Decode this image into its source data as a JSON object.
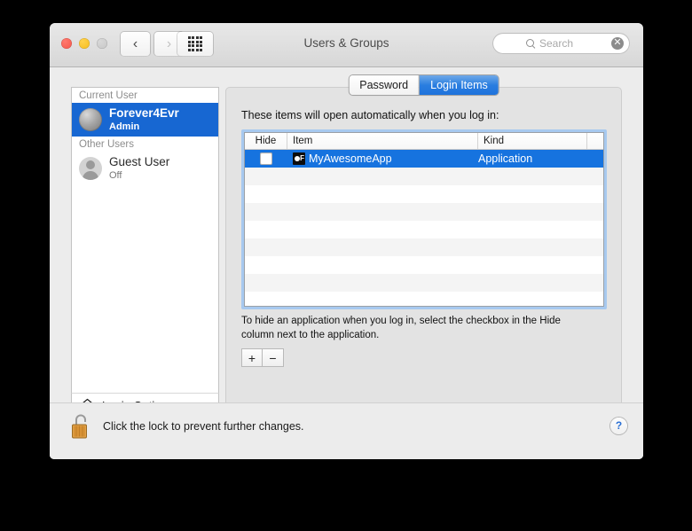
{
  "window": {
    "title": "Users & Groups",
    "traffic_lights": [
      "close",
      "minimize",
      "zoom"
    ]
  },
  "toolbar": {
    "back_label": "‹",
    "forward_label": "›",
    "show_all_label": "show-all-grid",
    "search": {
      "placeholder": "Search",
      "clear_label": "✕"
    }
  },
  "sidebar": {
    "groups": [
      {
        "header": "Current User",
        "users": [
          {
            "name": "Forever4Evr",
            "status": "Admin",
            "selected": true,
            "avatar": "shell"
          }
        ]
      },
      {
        "header": "Other Users",
        "users": [
          {
            "name": "Guest User",
            "status": "Off",
            "selected": false,
            "avatar": "guest"
          }
        ]
      }
    ],
    "login_options_label": "Login Options",
    "footer_buttons": [
      {
        "label": "+",
        "name": "add-user-button",
        "disabled": false
      },
      {
        "label": "−",
        "name": "remove-user-button",
        "disabled": true
      },
      {
        "label": "⚙",
        "name": "settings-gear-button",
        "disabled": false
      }
    ]
  },
  "content": {
    "tabs": [
      {
        "label": "Password",
        "active": false
      },
      {
        "label": "Login Items",
        "active": true
      }
    ],
    "intro": "These items will open automatically when you log in:",
    "table": {
      "columns": [
        "Hide",
        "Item",
        "Kind"
      ],
      "rows": [
        {
          "hide_checked": false,
          "item": "MyAwesomeApp",
          "kind": "Application",
          "selected": true
        }
      ],
      "empty_row_count": 8
    },
    "hint_line1": "To hide an application when you log in, select the checkbox in the Hide",
    "hint_line2": "column next to the application.",
    "add_button_label": "+",
    "remove_button_label": "−"
  },
  "lockbar": {
    "message": "Click the lock to prevent further changes.",
    "help_label": "?"
  },
  "colors": {
    "selection_blue": "#1673df",
    "sidebar_selection_blue": "#1767d2",
    "tab_active_blue": "#2a7ee0",
    "focus_ring": "#a7c9ef",
    "window_bg": "#ececec",
    "lock_gold": "#d99a3c"
  }
}
